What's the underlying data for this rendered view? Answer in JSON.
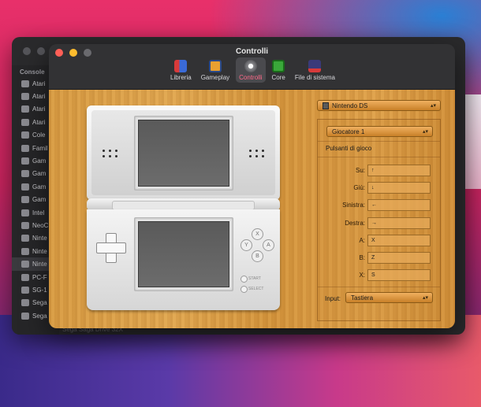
{
  "window": {
    "title": "Controlli"
  },
  "toolbar": {
    "tabs": [
      {
        "label": "Libreria",
        "icon": "library-icon"
      },
      {
        "label": "Gameplay",
        "icon": "gameplay-icon"
      },
      {
        "label": "Controlli",
        "icon": "controls-icon",
        "active": true
      },
      {
        "label": "Core",
        "icon": "core-icon"
      },
      {
        "label": "File di sistema",
        "icon": "system-files-icon"
      }
    ]
  },
  "back_window": {
    "sidebar_header": "Console",
    "items": [
      "Atari",
      "Atari",
      "Atari",
      "Atari",
      "Cole",
      "Famil",
      "Gam",
      "Gam",
      "Gam",
      "Gam",
      "Intel",
      "NeoC",
      "Ninte",
      "Ninte",
      "Ninte",
      "PC-F",
      "SG-1",
      "Sega",
      "Sega"
    ],
    "bottom_label": "Sega Saga Drive 32X"
  },
  "settings": {
    "console": "Nintendo DS",
    "player": "Giocatore 1",
    "section_title": "Pulsanti di gioco",
    "bindings": [
      {
        "label": "Su:",
        "value": "↑"
      },
      {
        "label": "Giù:",
        "value": "↓"
      },
      {
        "label": "Sinistra:",
        "value": "←"
      },
      {
        "label": "Destra:",
        "value": "→"
      },
      {
        "label": "A:",
        "value": "X"
      },
      {
        "label": "B:",
        "value": "Z"
      },
      {
        "label": "X:",
        "value": "S"
      }
    ],
    "input_label": "Input:",
    "input_value": "Tastiera"
  },
  "device": {
    "face_buttons": [
      "X",
      "Y",
      "A",
      "B"
    ],
    "start_label": "START",
    "select_label": "SELECT"
  }
}
